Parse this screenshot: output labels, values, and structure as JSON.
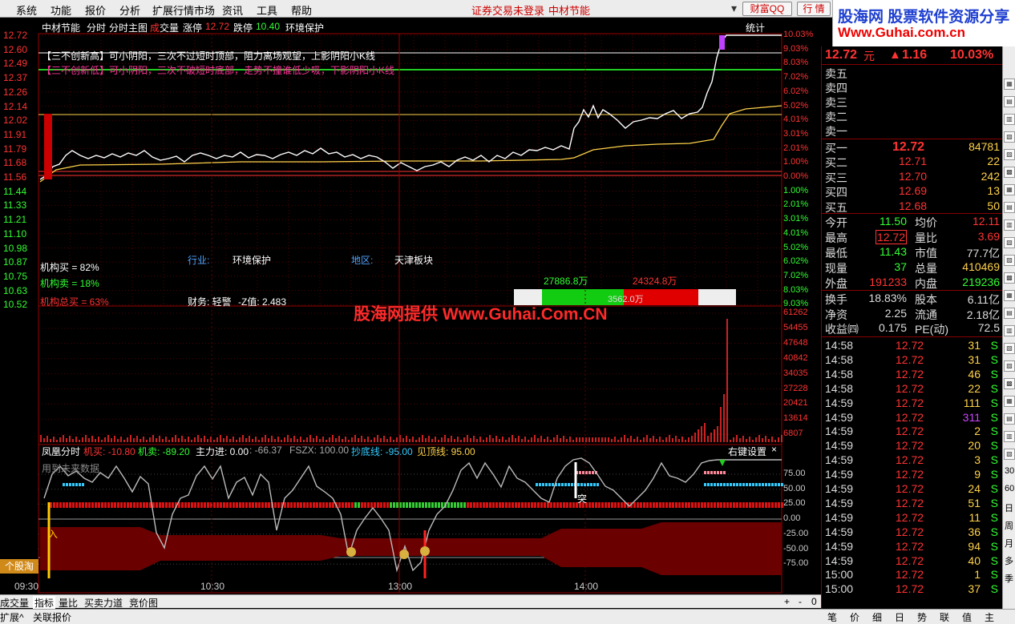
{
  "menu": [
    "系统",
    "功能",
    "报价",
    "分析",
    "扩展行情市场",
    "资讯",
    "工具",
    "帮助"
  ],
  "center_status": {
    "login": "证券交易未登录",
    "stock": "中材节能"
  },
  "top_buttons": {
    "wealth": "财富QQ",
    "trade": "行 情"
  },
  "logo": {
    "line1": "股海网 股票软件资源分享",
    "line2": "Www.Guhai.com.cn"
  },
  "chart_header": {
    "name": "中材节能",
    "mode1": "分时",
    "mode2": "分时主图",
    "vol_a": "成",
    "vol_b": "交量",
    "zt_label": "涨停",
    "zt_val": "12.72",
    "dt_label": "跌停",
    "dt_val": "10.40",
    "sector": "环境保护",
    "stat": "统计"
  },
  "price_axis": {
    "left": [
      "12.72",
      "12.60",
      "12.49",
      "12.37",
      "12.26",
      "12.14",
      "12.02",
      "11.91",
      "11.79",
      "11.68",
      "11.56",
      "11.44",
      "11.33",
      "11.21",
      "11.10",
      "10.98",
      "10.87",
      "10.75",
      "10.63",
      "10.52"
    ],
    "right": [
      "10.03%",
      "9.03%",
      "8.03%",
      "7.02%",
      "6.02%",
      "5.02%",
      "4.01%",
      "3.01%",
      "2.01%",
      "1.00%",
      "0.00%",
      "1.00%",
      "2.01%",
      "3.01%",
      "4.01%",
      "5.02%",
      "6.02%",
      "7.02%",
      "8.03%",
      "9.03%"
    ]
  },
  "volume_axis": [
    "61262",
    "54455",
    "47648",
    "40842",
    "34035",
    "27228",
    "20421",
    "13614",
    "6807"
  ],
  "notes": {
    "new_high": "【三不创新高】可小阴阳，三次不过短时顶部，阻力离场观望，上影阴阳小K线",
    "new_low": "【三不创新低】可小阴阳，三次不破短时底部，走势不撞谁低少吸，下影阴阳小K线"
  },
  "info_labels": {
    "industry_l": "行业:",
    "industry_v": "环境保护",
    "region_l": "地区:",
    "region_v": "天津板块",
    "inst_buy": "机构买 = 82%",
    "inst_sell": "机构卖 = 18%",
    "inst_total": "机构总买 = 63%",
    "finance": "财务: 轻警",
    "zscore": "-Z值: 2.483"
  },
  "flow_bar": {
    "left": "27886.8万",
    "right": "24324.8万",
    "center": "3562.0万"
  },
  "watermark": "股海网提供 Www.Guhai.Com.CN",
  "indicator": {
    "name": "凤凰分时",
    "jm": "机买: -10.80",
    "jmai": "机卖: -89.20",
    "zl": "主力进: 0.00",
    "v1": ": -66.37",
    "fszx": "FSZX: 100.00",
    "cdx": "抄底线: -95.00",
    "jdx": "见顶线: 95.00",
    "settings": "右键设置",
    "close": "×",
    "sub": "用到未来数据",
    "axis": [
      "75.00",
      "50.00",
      "25.00",
      "0.00",
      "-25.00",
      "-50.00",
      "-75.00"
    ],
    "mark_enter": "入",
    "mark_tu": "突",
    "gu": "个股淘"
  },
  "time_axis": [
    "09:30",
    "10:30",
    "13:00",
    "14:00"
  ],
  "quote": {
    "price": "12.72",
    "unit": "元",
    "change": "1.16",
    "pct": "10.03%",
    "sells": [
      "卖五",
      "卖四",
      "卖三",
      "卖二",
      "卖一"
    ],
    "buys": [
      {
        "label": "买一",
        "price": "12.72",
        "vol": "84781"
      },
      {
        "label": "买二",
        "price": "12.71",
        "vol": "22"
      },
      {
        "label": "买三",
        "price": "12.70",
        "vol": "242"
      },
      {
        "label": "买四",
        "price": "12.69",
        "vol": "13"
      },
      {
        "label": "买五",
        "price": "12.68",
        "vol": "50"
      }
    ],
    "stats": [
      {
        "l1": "今开",
        "v1": "11.50",
        "l2": "均价",
        "v2": "12.11"
      },
      {
        "l1": "最高",
        "v1": "12.72",
        "l2": "量比",
        "v2": "3.69"
      },
      {
        "l1": "最低",
        "v1": "11.43",
        "l2": "市值",
        "v2": "77.7亿"
      },
      {
        "l1": "现量",
        "v1": "37",
        "l2": "总量",
        "v2": "410469"
      },
      {
        "l1": "外盘",
        "v1": "191233",
        "l2": "内盘",
        "v2": "219236"
      }
    ],
    "stats2": [
      {
        "l1": "换手",
        "v1": "18.83%",
        "l2": "股本",
        "v2": "6.11亿"
      },
      {
        "l1": "净资",
        "v1": "2.25",
        "l2": "流通",
        "v2": "2.18亿"
      },
      {
        "l1": "收益㈣",
        "v1": "0.175",
        "l2": "PE(动)",
        "v2": "72.5"
      }
    ],
    "ticks": [
      {
        "t": "14:58",
        "p": "12.72",
        "v": "31",
        "s": "S"
      },
      {
        "t": "14:58",
        "p": "12.72",
        "v": "31",
        "s": "S"
      },
      {
        "t": "14:58",
        "p": "12.72",
        "v": "46",
        "s": "S"
      },
      {
        "t": "14:58",
        "p": "12.72",
        "v": "22",
        "s": "S"
      },
      {
        "t": "14:59",
        "p": "12.72",
        "v": "111",
        "s": "S"
      },
      {
        "t": "14:59",
        "p": "12.72",
        "v": "311",
        "s": "S"
      },
      {
        "t": "14:59",
        "p": "12.72",
        "v": "2",
        "s": "S"
      },
      {
        "t": "14:59",
        "p": "12.72",
        "v": "20",
        "s": "S"
      },
      {
        "t": "14:59",
        "p": "12.72",
        "v": "3",
        "s": "S"
      },
      {
        "t": "14:59",
        "p": "12.72",
        "v": "9",
        "s": "S"
      },
      {
        "t": "14:59",
        "p": "12.72",
        "v": "24",
        "s": "S"
      },
      {
        "t": "14:59",
        "p": "12.72",
        "v": "51",
        "s": "S"
      },
      {
        "t": "14:59",
        "p": "12.72",
        "v": "11",
        "s": "S"
      },
      {
        "t": "14:59",
        "p": "12.72",
        "v": "36",
        "s": "S"
      },
      {
        "t": "14:59",
        "p": "12.72",
        "v": "94",
        "s": "S"
      },
      {
        "t": "14:59",
        "p": "12.72",
        "v": "40",
        "s": "S"
      },
      {
        "t": "15:00",
        "p": "12.72",
        "v": "1",
        "s": "S"
      },
      {
        "t": "15:00",
        "p": "12.72",
        "v": "37",
        "s": "S"
      }
    ]
  },
  "bottom_tabs": [
    "成交量",
    "指标",
    "量比",
    "买卖力道",
    "竞价图"
  ],
  "bottom_tabs2": [
    "扩展^",
    "关联报价"
  ],
  "quote_tabs": [
    "笔",
    "价",
    "细",
    "日",
    "势",
    "联",
    "值",
    "主"
  ],
  "zoom_controls": [
    "+",
    "-",
    "0"
  ],
  "toolbar_labels": [
    "30",
    "60",
    "日",
    "周",
    "月",
    "多",
    "季"
  ],
  "colors": {
    "up": "#ff3333",
    "down": "#33ff33",
    "accent_yellow": "#ffd24a",
    "border": "#990000"
  }
}
